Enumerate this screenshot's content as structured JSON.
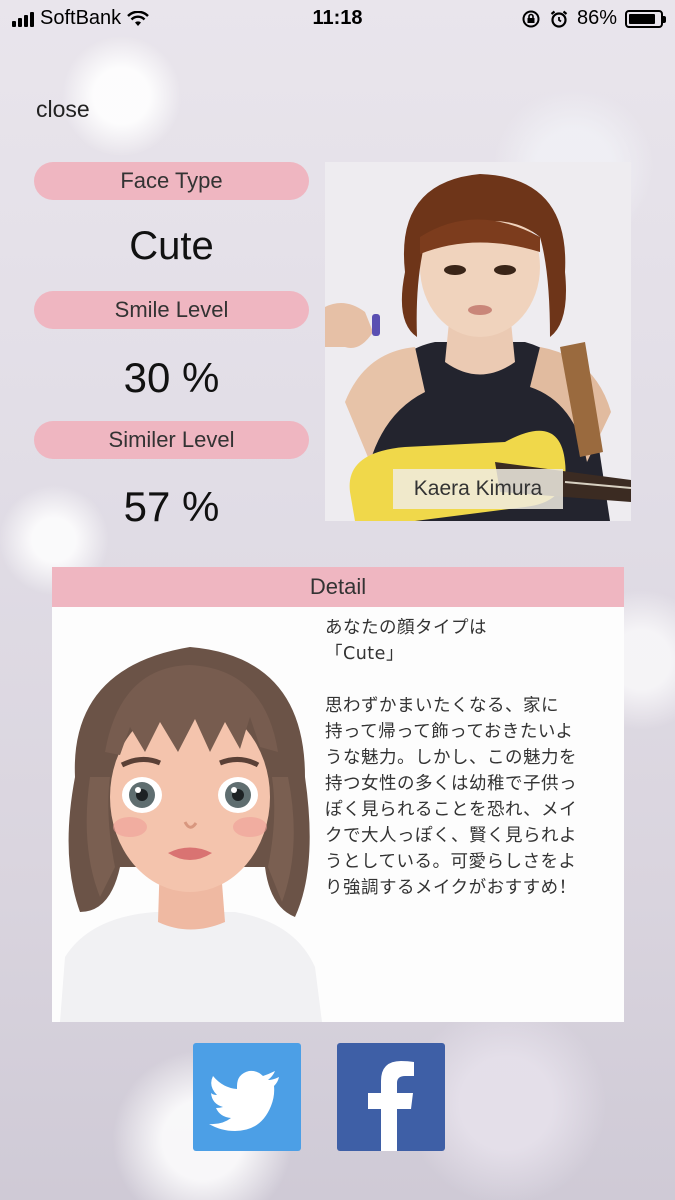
{
  "status_bar": {
    "carrier": "SoftBank",
    "time": "11:18",
    "battery_percent": "86%",
    "battery_level": 0.86,
    "icons": [
      "signal-icon",
      "wifi-icon",
      "orientation-lock-icon",
      "alarm-icon",
      "battery-icon"
    ]
  },
  "nav": {
    "close_label": "close"
  },
  "face_type": {
    "label": "Face Type",
    "value": "Cute"
  },
  "smile_level": {
    "label": "Smile Level",
    "value": "30 %"
  },
  "similar_level": {
    "label": "Similer Level",
    "value": "57 %"
  },
  "celebrity": {
    "name": "Kaera Kimura"
  },
  "detail": {
    "header": "Detail",
    "lines_intro": [
      "あなたの顔タイプは",
      "「Cute」"
    ],
    "lines_body": [
      "思わずかまいたくなる、家に",
      "持って帰って飾っておきたいよ",
      "うな魅力。しかし、この魅力を",
      "持つ女性の多くは幼稚で子供っ",
      "ぽく見られることを恐れ、メイ",
      "クで大人っぽく、賢く見られよ",
      "うとしている。可愛らしさをよ",
      "り強調するメイクがおすすめ！"
    ]
  },
  "share": {
    "icons": [
      "twitter-icon",
      "facebook-icon"
    ]
  },
  "colors": {
    "pill_pink": "#efb6c1",
    "twitter_blue": "#4c9fe6",
    "facebook_blue": "#3e5fa6"
  }
}
